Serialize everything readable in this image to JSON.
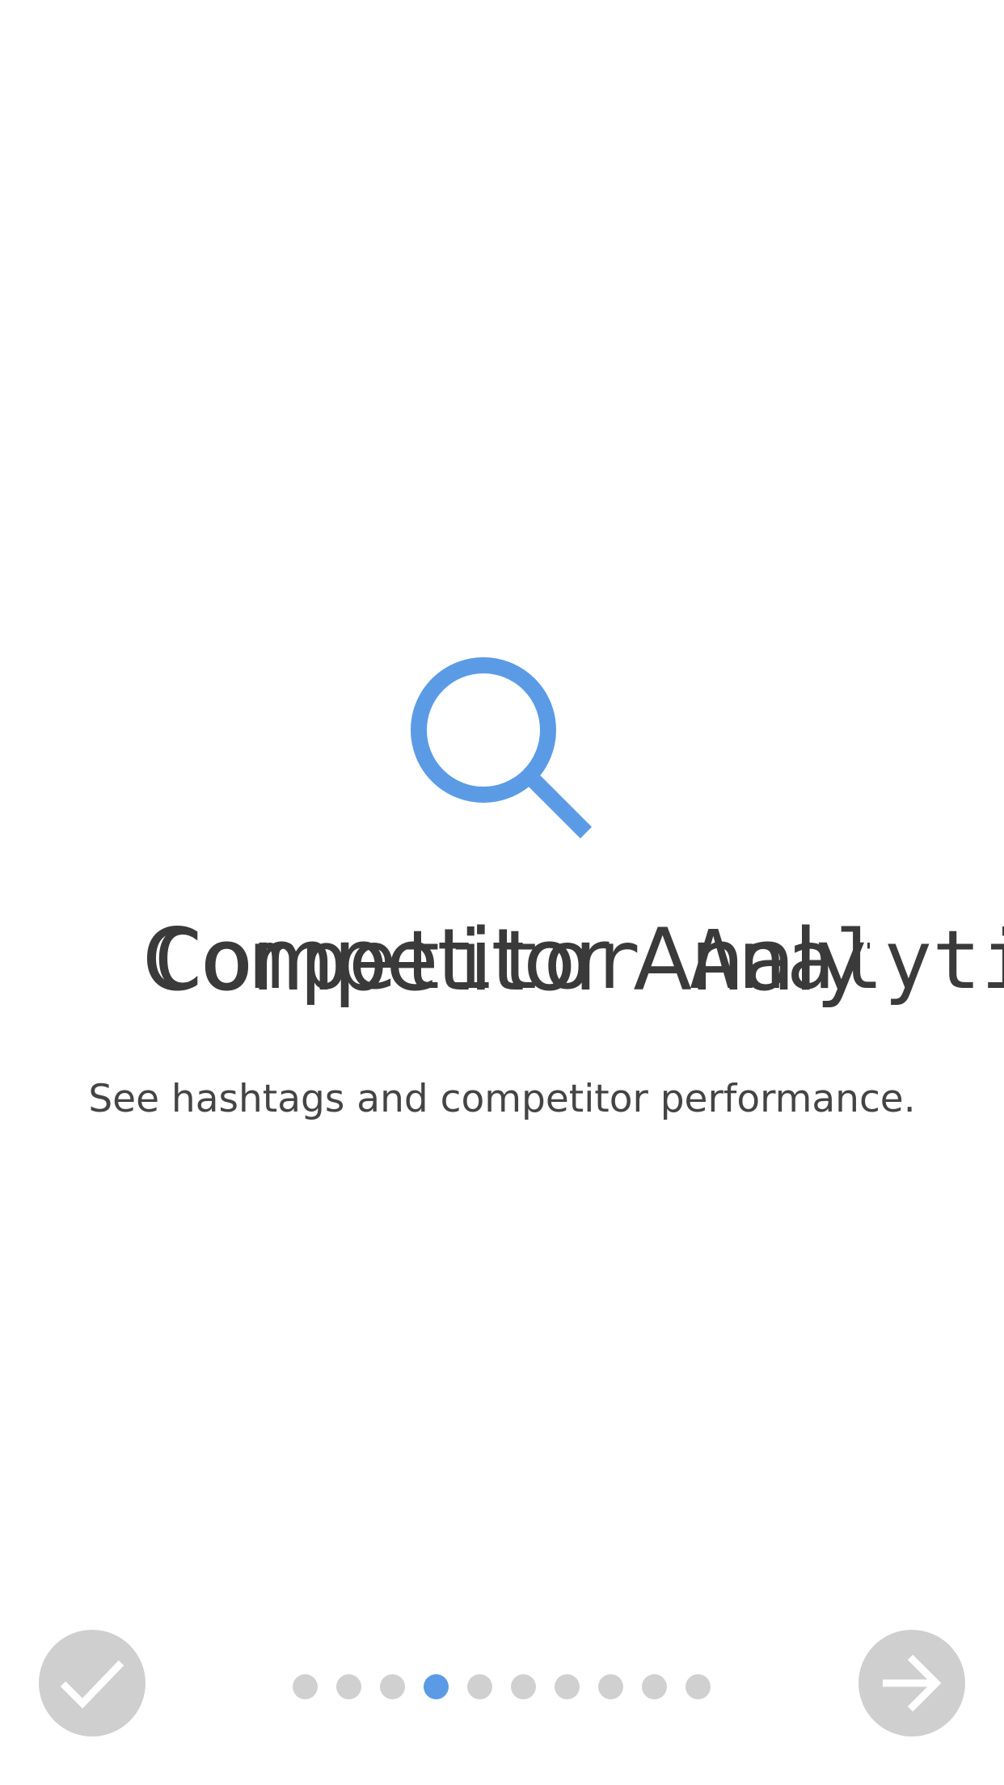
{
  "onboarding": {
    "title": "Competitor Analytics",
    "subtitle": "See hashtags and competitor performance.",
    "icon": "search-icon",
    "accent_color": "#5b9be6"
  },
  "pager": {
    "total": 10,
    "current": 4
  },
  "controls": {
    "done_icon": "checkmark-icon",
    "next_icon": "arrow-right-icon",
    "button_color": "#cfcfcf"
  }
}
